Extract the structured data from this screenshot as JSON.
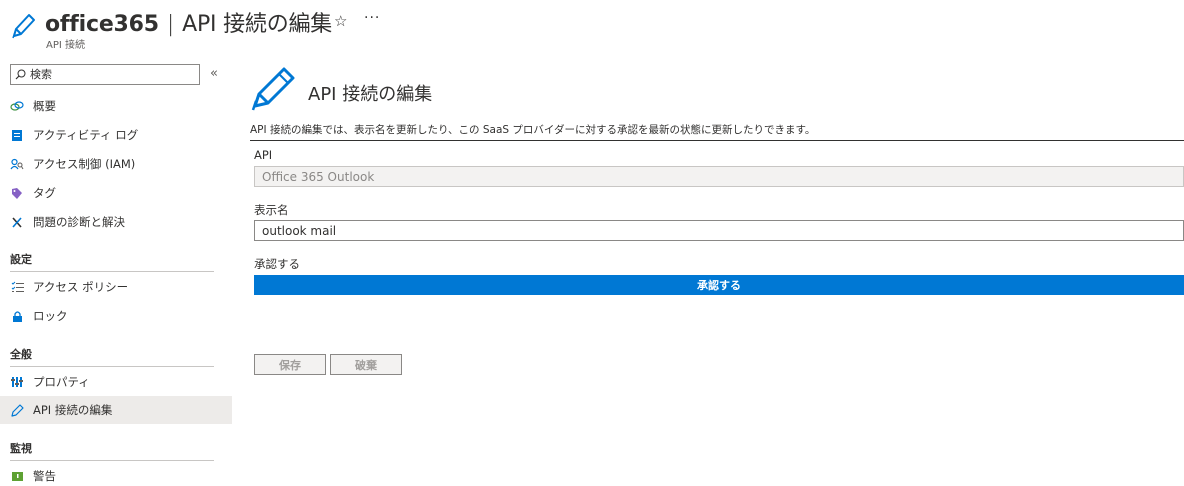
{
  "header": {
    "resource_name": "office365",
    "separator": "|",
    "page_title": "API 接続の編集",
    "subtitle": "API 接続",
    "star": "☆",
    "more": "···"
  },
  "sidebar": {
    "search_placeholder": "検索",
    "collapse": "«",
    "items_top": [
      {
        "label": "概要",
        "icon": "overview-icon"
      },
      {
        "label": "アクティビティ ログ",
        "icon": "activity-log-icon"
      },
      {
        "label": "アクセス制御 (IAM)",
        "icon": "iam-icon"
      },
      {
        "label": "タグ",
        "icon": "tag-icon"
      },
      {
        "label": "問題の診断と解決",
        "icon": "diagnose-icon"
      }
    ],
    "section_settings": "設定",
    "items_settings": [
      {
        "label": "アクセス ポリシー",
        "icon": "access-policy-icon"
      },
      {
        "label": "ロック",
        "icon": "lock-icon"
      }
    ],
    "section_general": "全般",
    "items_general": [
      {
        "label": "プロパティ",
        "icon": "properties-icon"
      },
      {
        "label": "API 接続の編集",
        "icon": "pencil-icon"
      }
    ],
    "section_monitoring": "監視",
    "items_monitoring": [
      {
        "label": "警告",
        "icon": "alert-icon"
      }
    ]
  },
  "main": {
    "title": "API 接続の編集",
    "description": "API 接続の編集では、表示名を更新したり、この SaaS プロバイダーに対する承認を最新の状態に更新したりできます。",
    "api_label": "API",
    "api_value": "Office 365 Outlook",
    "display_name_label": "表示名",
    "display_name_value": "outlook mail",
    "authorize_label": "承認する",
    "authorize_button": "承認する",
    "save_button": "保存",
    "discard_button": "破棄"
  },
  "colors": {
    "accent": "#0078d4",
    "active_bg": "#edebe9",
    "text": "#323130"
  }
}
